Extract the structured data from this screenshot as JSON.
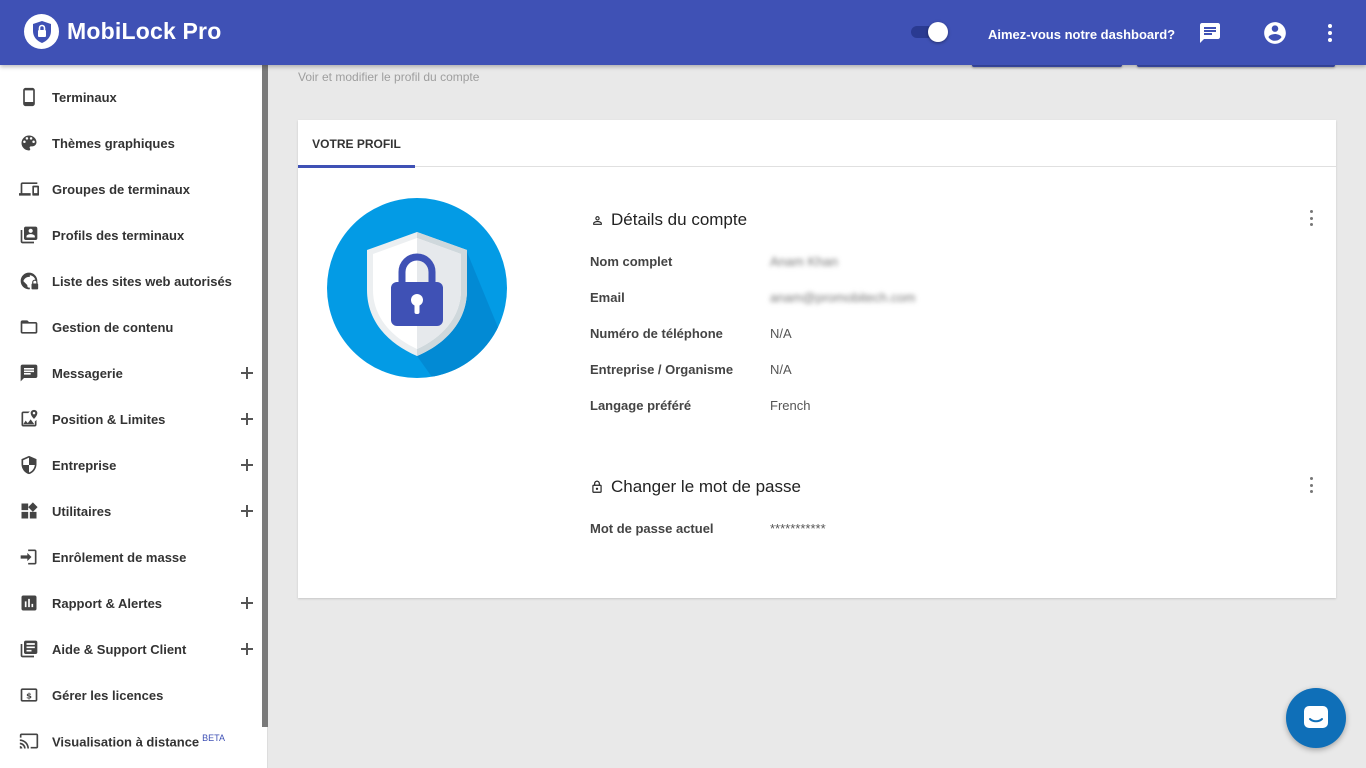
{
  "app": {
    "title": "MobiLock Pro"
  },
  "header": {
    "feedback_text": "Aimez-vous notre dashboard?",
    "icons": [
      "chat-icon",
      "account-circle-icon",
      "more-vert-icon"
    ]
  },
  "sidebar": {
    "items": [
      {
        "label": "Terminaux",
        "icon": "smartphone-icon",
        "expandable": false
      },
      {
        "label": "Thèmes graphiques",
        "icon": "palette-icon",
        "expandable": false
      },
      {
        "label": "Groupes de terminaux",
        "icon": "devices-icon",
        "expandable": false
      },
      {
        "label": "Profils des terminaux",
        "icon": "profiles-icon",
        "expandable": false
      },
      {
        "label": "Liste des sites web autorisés",
        "icon": "globe-lock-icon",
        "expandable": false
      },
      {
        "label": "Gestion de contenu",
        "icon": "folder-icon",
        "expandable": false
      },
      {
        "label": "Messagerie",
        "icon": "message-icon",
        "expandable": true
      },
      {
        "label": "Position & Limites",
        "icon": "map-pin-icon",
        "expandable": true
      },
      {
        "label": "Entreprise",
        "icon": "shield-icon",
        "expandable": true
      },
      {
        "label": "Utilitaires",
        "icon": "widgets-icon",
        "expandable": true
      },
      {
        "label": "Enrôlement de masse",
        "icon": "login-icon",
        "expandable": false
      },
      {
        "label": "Rapport & Alertes",
        "icon": "bar-chart-icon",
        "expandable": true
      },
      {
        "label": "Aide & Support Client",
        "icon": "library-books-icon",
        "expandable": true
      },
      {
        "label": "Gérer les licences",
        "icon": "license-icon",
        "expandable": false
      },
      {
        "label": "Visualisation à distance",
        "icon": "cast-icon",
        "expandable": false,
        "badge": "BETA"
      }
    ]
  },
  "main": {
    "subtitle": "Voir et modifier le profil du compte",
    "tabs": [
      {
        "label": "VOTRE PROFIL",
        "active": true
      }
    ],
    "account": {
      "title": "Détails du compte",
      "rows": [
        {
          "label": "Nom complet",
          "value": "Anam Khan",
          "blurred": true
        },
        {
          "label": "Email",
          "value": "anam@promobitech.com",
          "blurred": true
        },
        {
          "label": "Numéro de téléphone",
          "value": "N/A"
        },
        {
          "label": "Entreprise / Organisme",
          "value": "N/A"
        },
        {
          "label": "Langage préféré",
          "value": "French"
        }
      ]
    },
    "password": {
      "title": "Changer le mot de passe",
      "label": "Mot de passe actuel",
      "value": "***********"
    }
  },
  "colors": {
    "primary": "#3f51b5",
    "logo_blue": "#039be5",
    "chat": "#0f6fb8"
  }
}
